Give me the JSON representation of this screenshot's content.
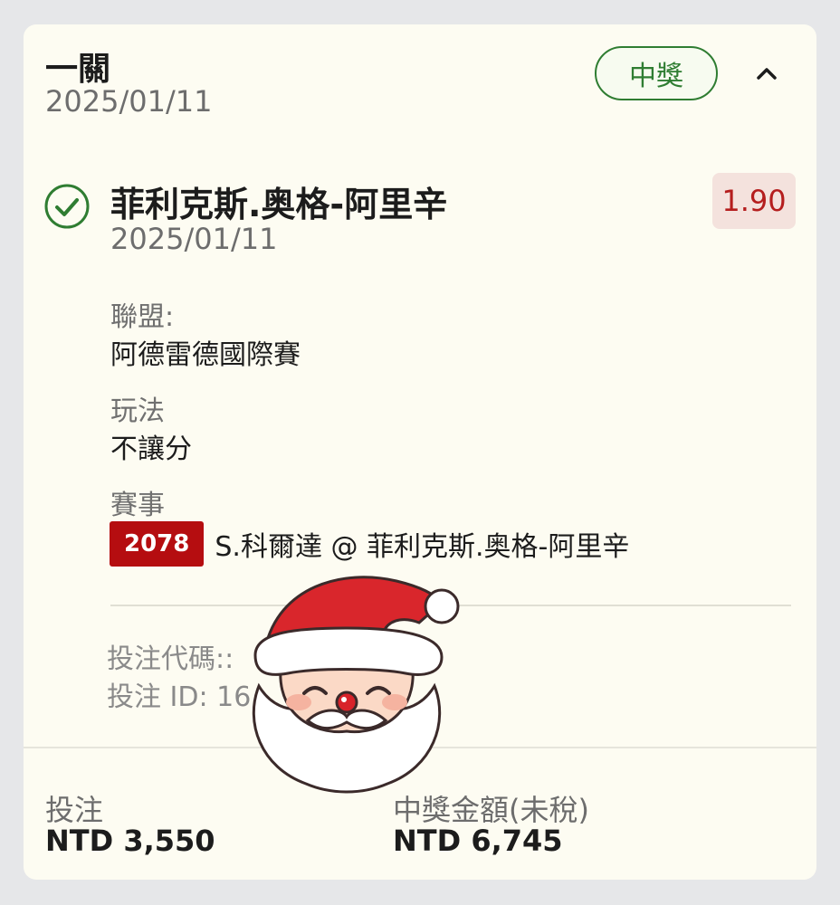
{
  "header": {
    "bet_type": "一關",
    "date": "2025/01/11",
    "status": "中獎"
  },
  "selection": {
    "title": "菲利克斯.奥格-阿里辛",
    "date": "2025/01/11",
    "odds": "1.90",
    "league_label": "聯盟:",
    "league_value": "阿德雷德國際賽",
    "market_label": "玩法",
    "market_value": "不讓分",
    "event_label": "賽事",
    "event_code": "2078",
    "event_name": "S.科爾達 @ 菲利克斯.奥格-阿里辛"
  },
  "meta": {
    "bet_code_text": "投注代碼::",
    "bet_id_text": "投注 ID: 16"
  },
  "footer": {
    "stake_label": "投注",
    "stake_value": "NTD 3,550",
    "payout_label": "中獎金額(未稅)",
    "payout_value": "NTD 6,745"
  },
  "colors": {
    "win_green": "#2f7d32",
    "odds_red": "#b51e1e",
    "event_code_bg": "#b50d10",
    "card_bg": "#fdfcf2"
  },
  "icons": {
    "status_check": "check-circle-icon",
    "collapse": "chevron-up-icon",
    "overlay": "santa-sticker"
  }
}
